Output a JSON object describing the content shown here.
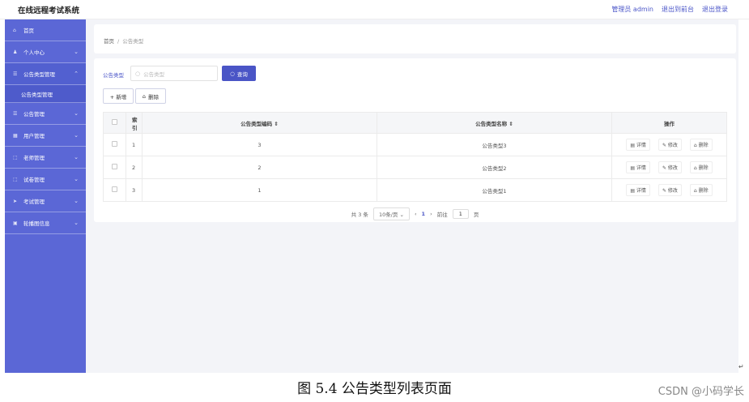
{
  "app": {
    "title": "在线远程考试系统",
    "admin_label": "管理员 admin",
    "front_link": "退出到前台",
    "logout_link": "退出登录"
  },
  "sidebar": {
    "items": [
      {
        "label": "首页",
        "icon": "home-icon",
        "glyph": "⌂",
        "chevron": ""
      },
      {
        "label": "个人中心",
        "icon": "user-icon",
        "glyph": "♟",
        "chevron": "⌄"
      },
      {
        "label": "公告类型管理",
        "icon": "list-icon",
        "glyph": "☰",
        "chevron": "⌃"
      },
      {
        "label": "公告管理",
        "icon": "list-icon",
        "glyph": "☰",
        "chevron": "⌄"
      },
      {
        "label": "用户管理",
        "icon": "grid-icon",
        "glyph": "▦",
        "chevron": "⌄"
      },
      {
        "label": "老师管理",
        "icon": "frame-icon",
        "glyph": "⬚",
        "chevron": "⌄"
      },
      {
        "label": "试卷管理",
        "icon": "frame-icon",
        "glyph": "⬚",
        "chevron": "⌄"
      },
      {
        "label": "考试管理",
        "icon": "send-icon",
        "glyph": "➤",
        "chevron": "⌄"
      },
      {
        "label": "轮播图信息",
        "icon": "image-icon",
        "glyph": "▣",
        "chevron": "⌄"
      }
    ],
    "subitem": "公告类型管理"
  },
  "breadcrumb": {
    "home": "首页",
    "sep": "/",
    "current": "公告类型"
  },
  "search": {
    "label": "公告类型",
    "placeholder": "公告类型",
    "button": "查询"
  },
  "toolbar": {
    "add": "+ 新增",
    "delete": "删除"
  },
  "table": {
    "headers": {
      "index": "索引",
      "code": "公告类型编码",
      "name": "公告类型名称",
      "ops": "操作"
    },
    "rows": [
      {
        "index": "1",
        "code": "3",
        "name": "公告类型3"
      },
      {
        "index": "2",
        "code": "2",
        "name": "公告类型2"
      },
      {
        "index": "3",
        "code": "1",
        "name": "公告类型1"
      }
    ],
    "op_labels": {
      "detail": "详情",
      "edit": "修改",
      "delete": "删除"
    }
  },
  "pager": {
    "total": "共 3 条",
    "page_size": "10条/页",
    "current_page": "1",
    "goto_label": "前往",
    "goto_value": "1",
    "page_unit": "页"
  },
  "caption": "图 5.4 公告类型列表页面",
  "watermark": "CSDN @小码学长"
}
